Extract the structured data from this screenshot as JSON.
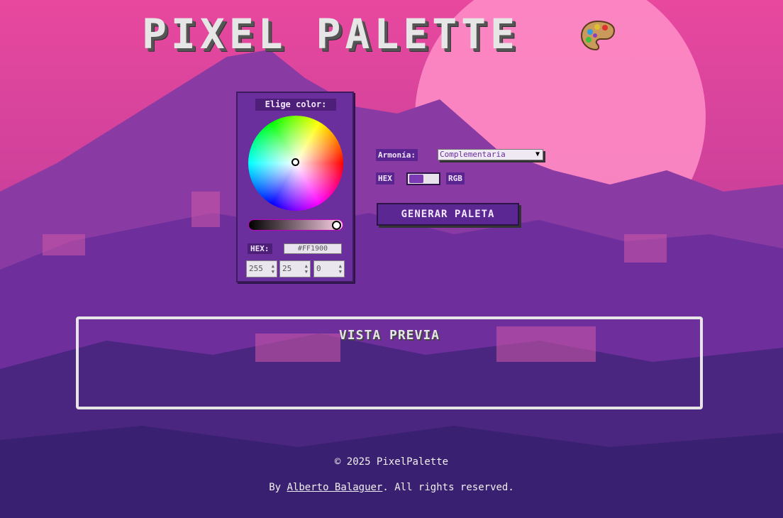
{
  "header": {
    "title": "PIXEL PALETTE",
    "icon": "palette-icon"
  },
  "picker": {
    "label": "Elige color:",
    "hex_label": "HEX:",
    "hex_value": "#FF1900",
    "r": "255",
    "g": "25",
    "b": "0",
    "lightness": 1.0
  },
  "controls": {
    "harmony_label": "Armonía:",
    "harmony_value": "Complementaria",
    "format_left": "HEX",
    "format_right": "RGB",
    "generate_label": "GENERAR PALETA"
  },
  "preview": {
    "title": "VISTA PREVIA"
  },
  "footer": {
    "copyright": "© 2025 PixelPalette",
    "by": "By ",
    "author": "Alberto Balaguer",
    "rights": ". All rights reserved."
  },
  "colors": {
    "accent": "#6a2f9c",
    "sky": "#e0479a",
    "sun": "#ff8fc8"
  }
}
